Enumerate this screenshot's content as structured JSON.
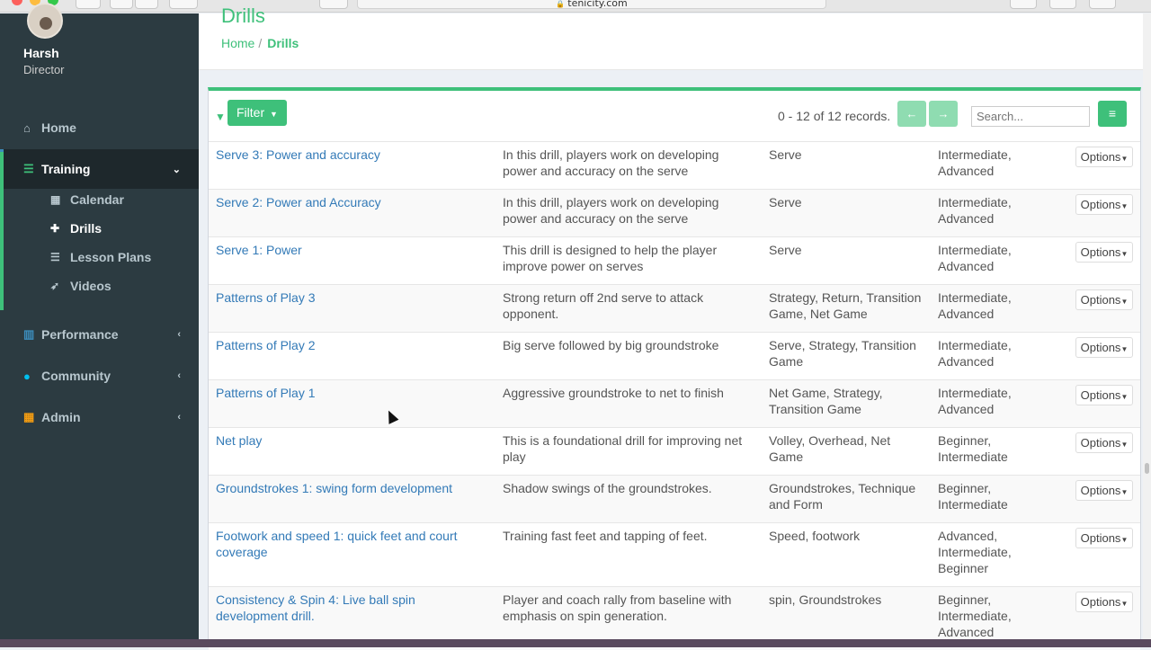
{
  "browser": {
    "url": "tenicity.com"
  },
  "user": {
    "name": "Harsh",
    "role": "Director"
  },
  "sidebar": {
    "items": [
      {
        "label": "Home",
        "icon": "home-icon"
      },
      {
        "label": "Training",
        "icon": "training-icon"
      },
      {
        "label": "Performance",
        "icon": "chart-icon"
      },
      {
        "label": "Community",
        "icon": "user-icon"
      },
      {
        "label": "Admin",
        "icon": "grid-icon"
      }
    ],
    "training_sub": [
      {
        "label": "Calendar",
        "icon": "calendar-icon"
      },
      {
        "label": "Drills",
        "icon": "move-icon"
      },
      {
        "label": "Lesson Plans",
        "icon": "list-icon"
      },
      {
        "label": "Videos",
        "icon": "rocket-icon"
      }
    ]
  },
  "header": {
    "title": "Drills"
  },
  "breadcrumb": {
    "home": "Home",
    "sep": "/",
    "current": "Drills"
  },
  "toolbar": {
    "filter_label": "Filter",
    "records": "0 - 12 of 12 records.",
    "search_placeholder": "Search..."
  },
  "options_label": "Options",
  "drills": [
    {
      "name": "Serve 3: Power and accuracy",
      "desc": "In this drill, players work on developing power and accuracy on the serve",
      "tags": "Serve",
      "level": "Intermediate, Advanced"
    },
    {
      "name": "Serve 2: Power and Accuracy",
      "desc": "In this drill, players work on developing power and accuracy on the serve",
      "tags": "Serve",
      "level": "Intermediate, Advanced"
    },
    {
      "name": "Serve 1: Power",
      "desc": "This drill is designed to help the player improve power on serves",
      "tags": "Serve",
      "level": "Intermediate, Advanced"
    },
    {
      "name": "Patterns of Play 3",
      "desc": "Strong return off 2nd serve to attack opponent.",
      "tags": "Strategy, Return, Transition Game, Net Game",
      "level": "Intermediate, Advanced"
    },
    {
      "name": "Patterns of Play 2",
      "desc": "Big serve followed by big groundstroke",
      "tags": "Serve, Strategy, Transition Game",
      "level": "Intermediate, Advanced"
    },
    {
      "name": "Patterns of Play 1",
      "desc": "Aggressive groundstroke to net to finish",
      "tags": "Net Game, Strategy, Transition Game",
      "level": "Intermediate, Advanced"
    },
    {
      "name": "Net play",
      "desc": "This is a foundational drill for improving net play",
      "tags": "Volley, Overhead, Net Game",
      "level": "Beginner, Intermediate"
    },
    {
      "name": "Groundstrokes 1: swing form development",
      "desc": "Shadow swings of the groundstrokes.",
      "tags": "Groundstrokes, Technique and Form",
      "level": "Beginner, Intermediate"
    },
    {
      "name": "Footwork and speed 1: quick feet and court coverage",
      "desc": "Training fast feet and tapping of feet.",
      "tags": "Speed, footwork",
      "level": "Advanced, Intermediate, Beginner"
    },
    {
      "name": "Consistency & Spin 4: Live ball spin development drill.",
      "desc": "Player and coach rally from baseline with emphasis on spin generation.",
      "tags": "spin, Groundstrokes",
      "level": "Beginner, Intermediate, Advanced"
    }
  ]
}
